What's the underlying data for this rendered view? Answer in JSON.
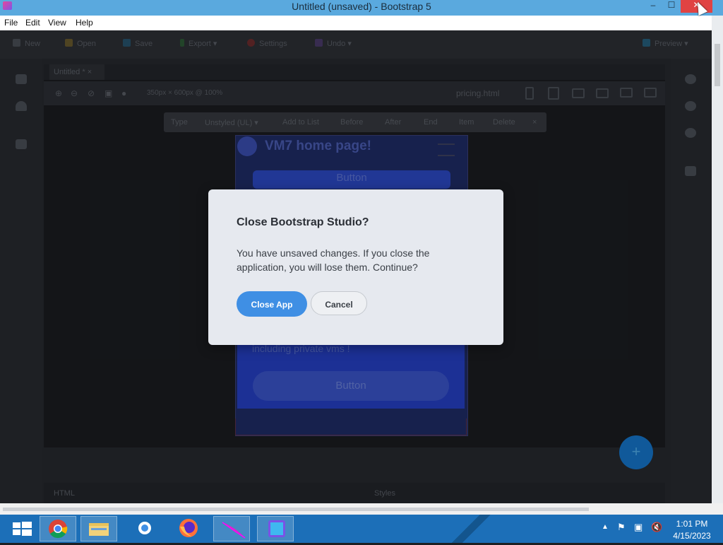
{
  "window": {
    "title": "Untitled (unsaved) - Bootstrap 5",
    "minimize_glyph": "–",
    "maximize_glyph": "☐",
    "close_glyph": "✕"
  },
  "menu": [
    "File",
    "Edit",
    "View",
    "Help"
  ],
  "toolbar": {
    "new": "New",
    "open": "Open",
    "save": "Save",
    "export": "Export",
    "settings": "Settings",
    "undo": "Undo",
    "preview": "Preview"
  },
  "editor": {
    "tab": "Untitled *",
    "viewport": "350px × 600px @ 100%",
    "page": "pricing.html"
  },
  "context_bar": [
    "Type",
    "Unstyled (UL)",
    "Add to List",
    "Before",
    "After",
    "End",
    "Item",
    "Delete",
    "×"
  ],
  "preview": {
    "title": "VM7 home page!",
    "button_top": "Button",
    "text": "including private vms !",
    "button_bottom": "Button",
    "fab": "+"
  },
  "panels": {
    "html": "HTML",
    "styles": "Styles"
  },
  "dialog": {
    "title": "Close Bootstrap Studio?",
    "message": "You have unsaved changes. If you close the application, you will lose them. Continue?",
    "confirm": "Close App",
    "cancel": "Cancel"
  },
  "taskbar": {
    "apps": [
      "start-icon",
      "chrome-icon",
      "file-explorer-icon",
      "settings-icon",
      "firefox-icon",
      "feather-icon",
      "bootstrap-studio-icon"
    ],
    "time": "1:01 PM",
    "date": "4/15/2023"
  },
  "colors": {
    "titlebar": "#5aa9de",
    "close": "#e04343",
    "accent": "#3f8fe4",
    "taskbar": "#1c6fb8"
  }
}
